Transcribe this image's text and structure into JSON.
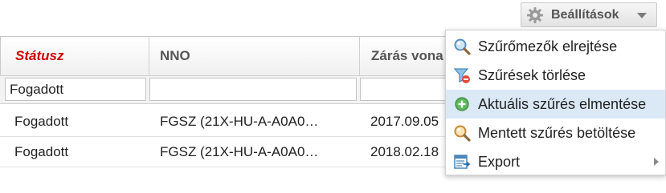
{
  "toolbar": {
    "settings_label": "Beállítások",
    "settings_icon": "gear-icon",
    "caret_icon": "chevron-down-icon"
  },
  "table": {
    "columns": [
      "Státusz",
      "NNO",
      "Zárás vona"
    ],
    "filters": {
      "status_value": "Fogadott",
      "nno_value": "",
      "zaras_value": ""
    },
    "rows": [
      {
        "status": "Fogadott",
        "nno": "FGSZ (21X-HU-A-A0A0…",
        "zaras": "2017.09.05"
      },
      {
        "status": "Fogadott",
        "nno": "FGSZ (21X-HU-A-A0A0…",
        "zaras": "2018.02.18"
      }
    ]
  },
  "menu": {
    "items": [
      {
        "label": "Szűrőmezők elrejtése",
        "icon": "magnifier-icon"
      },
      {
        "label": "Szűrések törlése",
        "icon": "filter-remove-icon"
      },
      {
        "label": "Aktuális szűrés elmentése",
        "icon": "add-green-icon"
      },
      {
        "label": "Mentett szűrés betöltése",
        "icon": "magnifier-load-icon"
      },
      {
        "label": "Export",
        "icon": "export-icon",
        "submenu_icon": "chevron-right-icon"
      }
    ]
  },
  "colors": {
    "status_header": "#d10000",
    "menu_highlight": "#dbe8f6"
  }
}
